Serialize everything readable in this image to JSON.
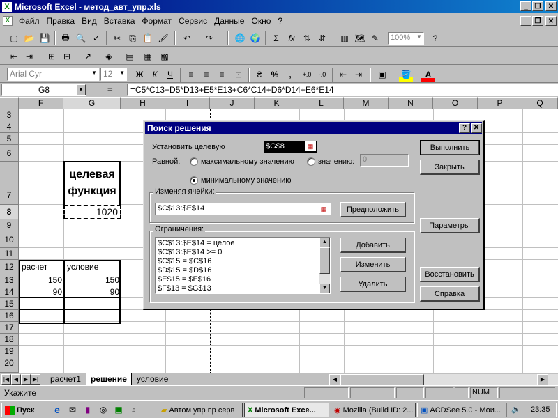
{
  "window": {
    "title": "Microsoft Excel - метод_авт_упр.xls",
    "min": "_",
    "max": "❐",
    "close": "✕"
  },
  "menu": [
    "Файл",
    "Правка",
    "Вид",
    "Вставка",
    "Формат",
    "Сервис",
    "Данные",
    "Окно",
    "?"
  ],
  "toolbar": {
    "zoom": "100%",
    "font": "Arial Cyr",
    "size": "12",
    "bold": "Ж",
    "italic": "К",
    "underline": "Ч",
    "percent": "%",
    "comma": ","
  },
  "formula_bar": {
    "name_box": "G8",
    "equals": "=",
    "formula": "=C5*C13+D5*D13+E5*E13+C6*C14+D6*D14+E6*E14"
  },
  "columns": [
    "F",
    "G",
    "H",
    "I",
    "J",
    "K",
    "L",
    "M",
    "N",
    "O",
    "P",
    "Q"
  ],
  "rows": [
    "3",
    "4",
    "5",
    "6",
    "7",
    "8",
    "9",
    "10",
    "11",
    "12",
    "13",
    "14",
    "15",
    "16",
    "17",
    "18",
    "19",
    "20"
  ],
  "cells": {
    "g7_line1": "целевая",
    "g7_line2": "функция",
    "g8": "1020",
    "f12": "расчет",
    "g12": "условие",
    "f13": "150",
    "g13": "150",
    "f14": "90",
    "g14": "90"
  },
  "dialog": {
    "title": "Поиск решения",
    "help_btn": "?",
    "close_btn": "✕",
    "target_label": "Установить целевую",
    "target_value": "$G$8",
    "equal_label": "Равной:",
    "max_label": "максимальному значению",
    "value_label": "значению:",
    "value_input": "0",
    "min_label": "минимальному значению",
    "changing_label": "Изменяя ячейки:",
    "changing_value": "$C$13:$E$14",
    "guess_btn": "Предположить",
    "constraints_label": "Ограничения:",
    "constraints": [
      "$C$13:$E$14 = целое",
      "$C$13:$E$14 >= 0",
      "$C$15 = $C$16",
      "$D$15 = $D$16",
      "$E$15 = $E$16",
      "$F$13 = $G$13"
    ],
    "add_btn": "Добавить",
    "change_btn": "Изменить",
    "delete_btn": "Удалить",
    "solve_btn": "Выполнить",
    "close_label": "Закрыть",
    "options_btn": "Параметры",
    "reset_btn": "Восстановить",
    "help_label": "Справка"
  },
  "sheets": [
    "расчет1",
    "решение",
    "условие"
  ],
  "status": {
    "mode": "Укажите",
    "num": "NUM"
  },
  "taskbar": {
    "start": "Пуск",
    "tasks": [
      "Автом упр пр серв",
      "Microsoft Exce...",
      "Mozilla (Build ID: 2...",
      "ACDSee 5.0 - Мои..."
    ],
    "clock": "23:35"
  }
}
